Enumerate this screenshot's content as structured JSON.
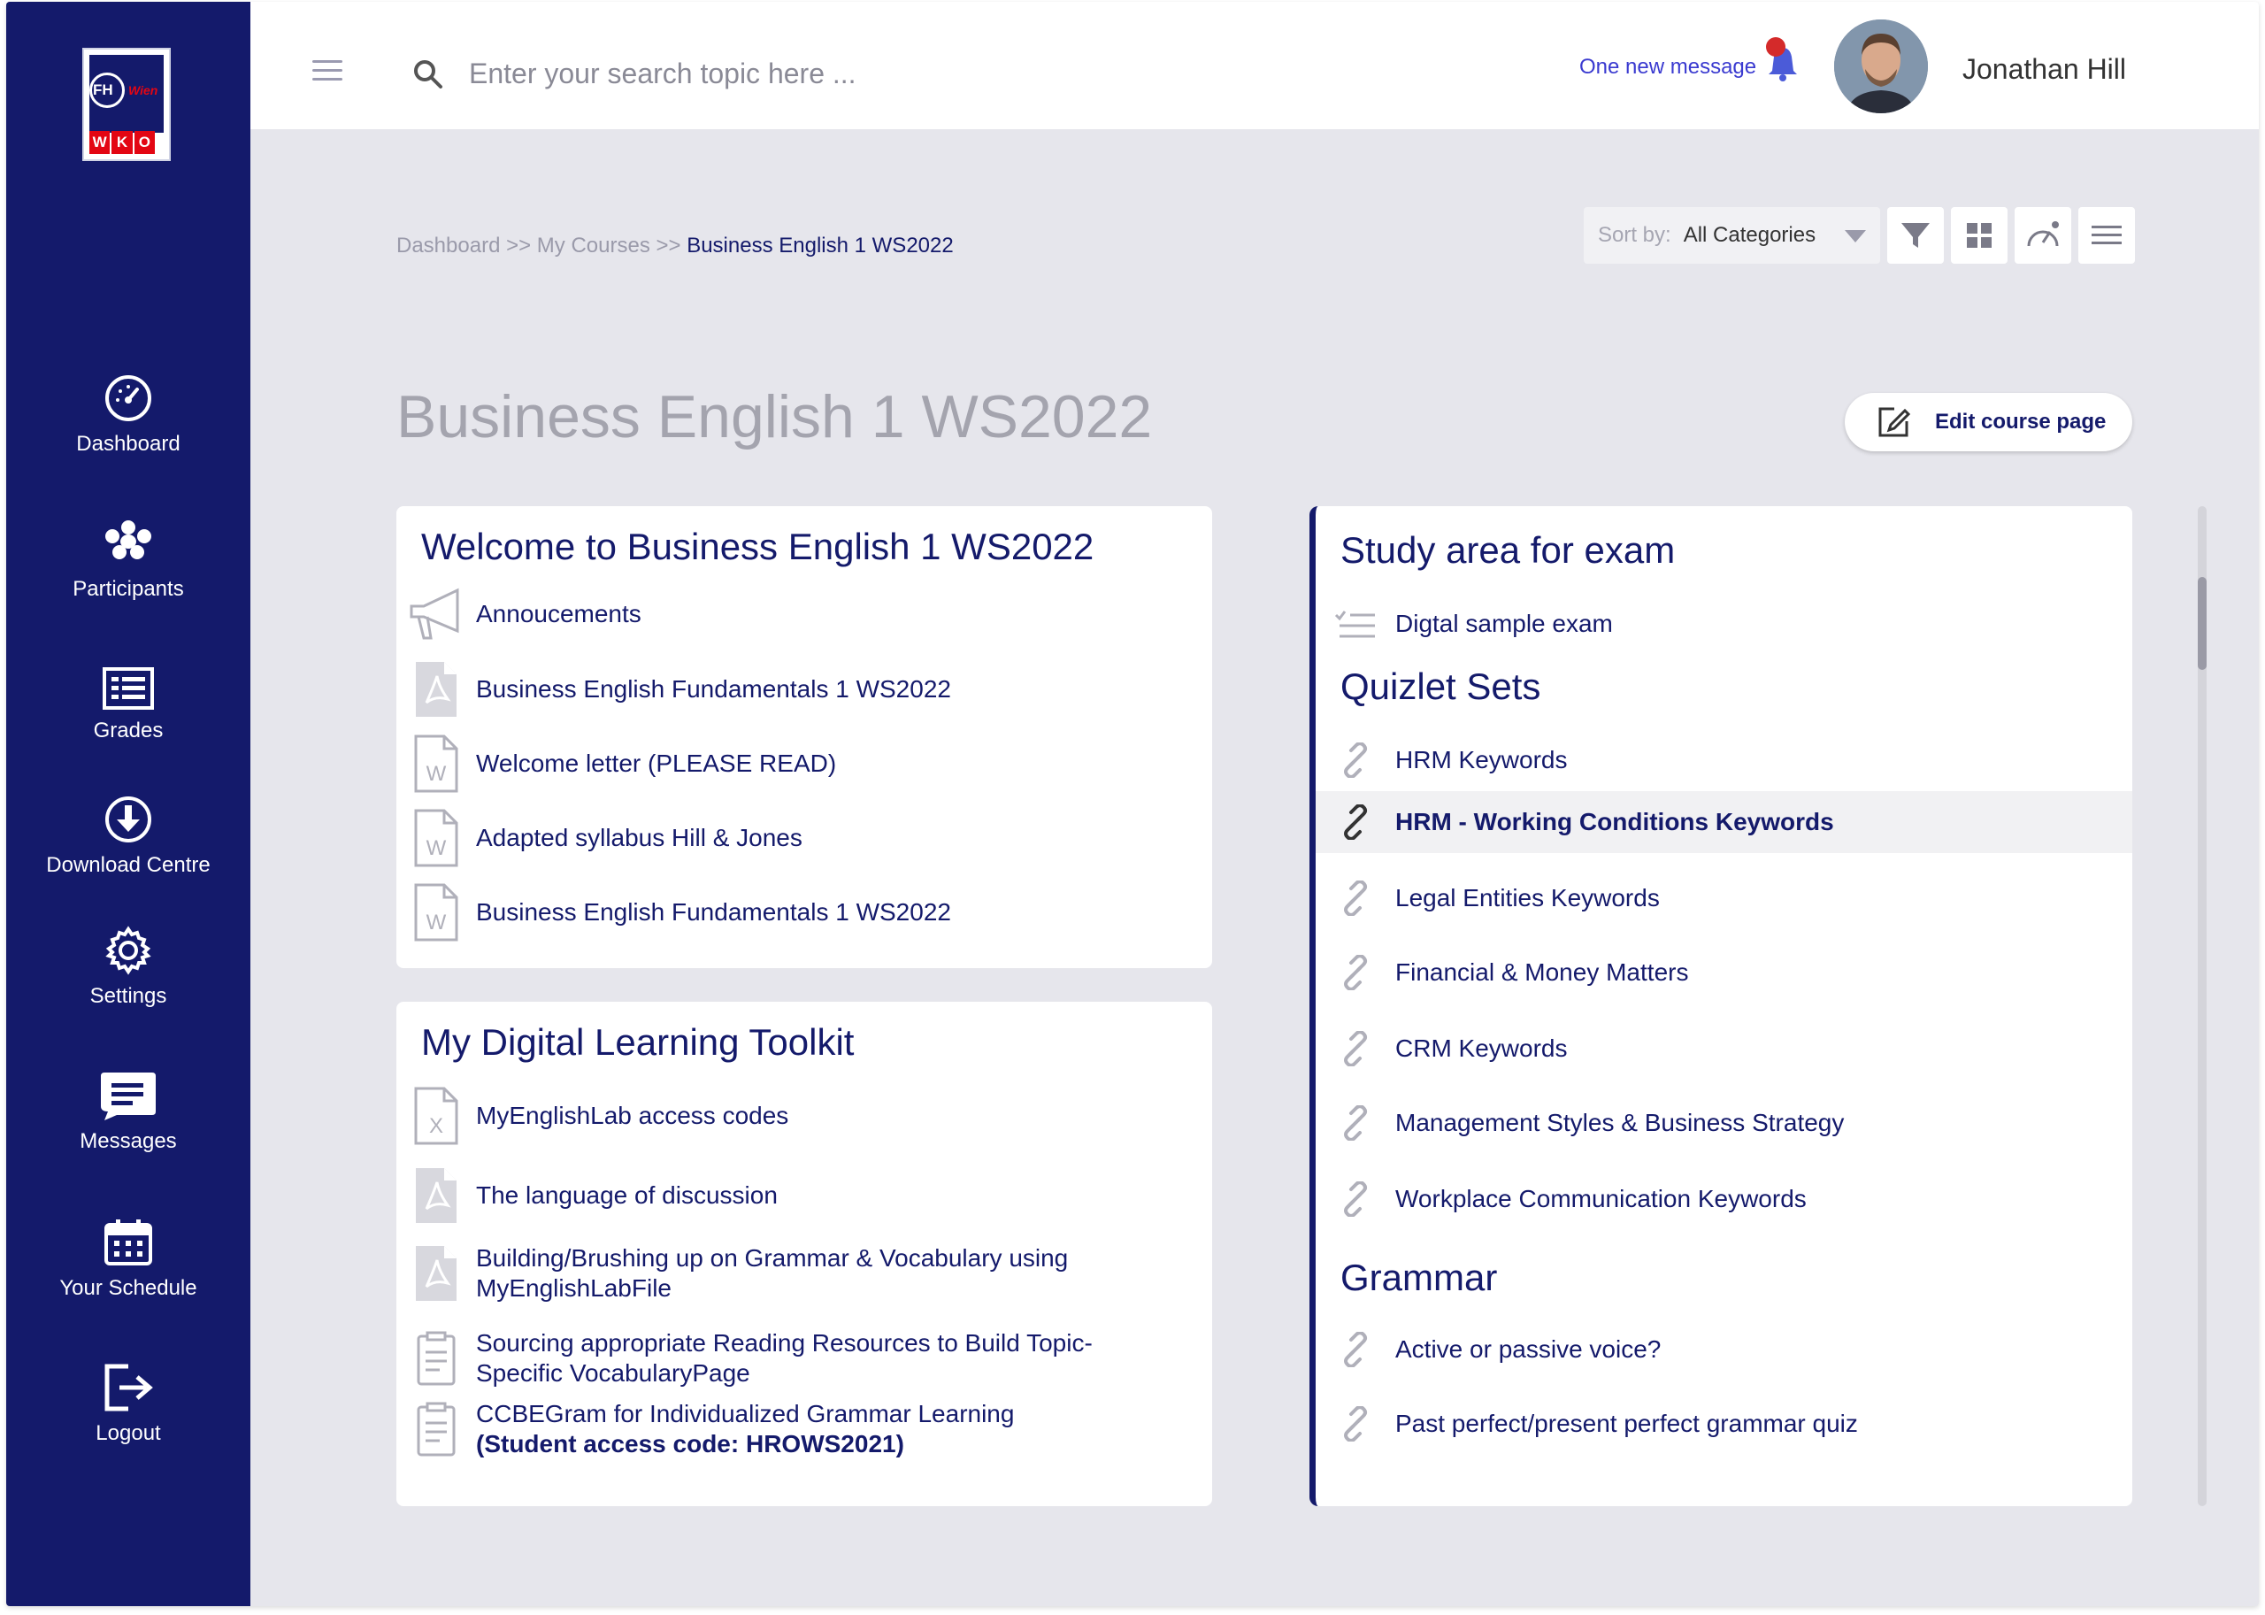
{
  "colors": {
    "sidebar": "#141a6b",
    "accent": "#3a3ad0",
    "notification": "#d42a2a",
    "background": "#e6e6ec"
  },
  "sidebar": {
    "logo_text": {
      "fh": "FH",
      "wien": "Wien",
      "wko": [
        "W",
        "K",
        "O"
      ]
    },
    "items": [
      {
        "label": "Dashboard",
        "icon": "dashboard-gauge-icon"
      },
      {
        "label": "Participants",
        "icon": "participants-group-icon"
      },
      {
        "label": "Grades",
        "icon": "grades-list-icon"
      },
      {
        "label": "Download Centre",
        "icon": "download-circle-icon"
      },
      {
        "label": "Settings",
        "icon": "settings-gear-icon"
      },
      {
        "label": "Messages",
        "icon": "messages-chat-icon"
      },
      {
        "label": "Your Schedule",
        "icon": "calendar-icon"
      },
      {
        "label": "Logout",
        "icon": "logout-icon"
      }
    ]
  },
  "header": {
    "search_placeholder": "Enter your search topic here ...",
    "notification_text": "One new message",
    "user_name": "Jonathan Hill"
  },
  "breadcrumb": {
    "part1": "Dashboard",
    "sep": ">>",
    "part2": "My Courses",
    "current": "Business English 1 WS2022"
  },
  "toolbar": {
    "sort_label": "Sort by:",
    "sort_value": "All Categories"
  },
  "page": {
    "title": "Business English 1 WS2022",
    "edit_button": "Edit course page"
  },
  "welcome_card": {
    "title": "Welcome to Business English 1 WS2022",
    "items": [
      {
        "label": "Annoucements",
        "icon": "megaphone-icon"
      },
      {
        "label": "Business English Fundamentals 1 WS2022",
        "icon": "pdf-file-icon"
      },
      {
        "label": "Welcome letter (PLEASE READ)",
        "icon": "word-file-icon"
      },
      {
        "label": "Adapted syllabus Hill & Jones",
        "icon": "word-file-icon"
      },
      {
        "label": "Business English Fundamentals 1 WS2022",
        "icon": "word-file-icon"
      }
    ]
  },
  "toolkit_card": {
    "title": "My Digital Learning Toolkit",
    "items": [
      {
        "label": "MyEnglishLab access codes",
        "icon": "excel-file-icon"
      },
      {
        "label": "The language of discussion",
        "icon": "pdf-file-icon"
      },
      {
        "label": "Building/Brushing up on Grammar & Vocabulary using",
        "label2": "MyEnglishLabFile",
        "icon": "pdf-file-icon"
      },
      {
        "label": "Sourcing appropriate Reading Resources to Build Topic-",
        "label2": "Specific VocabularyPage",
        "icon": "page-icon"
      },
      {
        "label": "CCBEGram for Individualized Grammar Learning",
        "label2": "(Student access code: HROWS2021)",
        "icon": "page-icon"
      }
    ]
  },
  "study_card": {
    "exam_title": "Study area for exam",
    "exam_item": "Digtal sample exam",
    "quizlet_title": "Quizlet Sets",
    "quizlet_items": [
      "HRM Keywords",
      "HRM - Working Conditions Keywords",
      "Legal Entities Keywords",
      "Financial & Money Matters",
      "CRM Keywords",
      "Management Styles & Business Strategy",
      "Workplace Communication Keywords"
    ],
    "grammar_title": "Grammar",
    "grammar_items": [
      "Active or passive voice?",
      "Past perfect/present perfect grammar quiz"
    ]
  }
}
